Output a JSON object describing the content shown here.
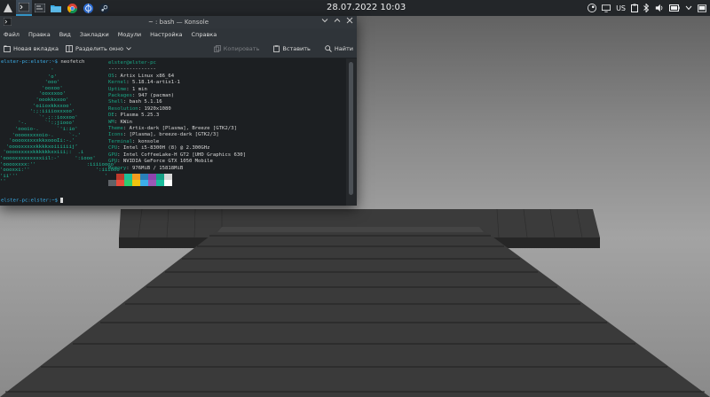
{
  "panel": {
    "clock": "28.07.2022 10:03",
    "lang": "US",
    "tasks": [
      {
        "name": "konsole-task-icon",
        "active": true
      },
      {
        "name": "terminal-task-icon"
      },
      {
        "name": "file-manager-task-icon"
      },
      {
        "name": "chrome-task-icon"
      },
      {
        "name": "browser-task-icon"
      },
      {
        "name": "steam-task-icon"
      }
    ]
  },
  "window": {
    "title": "~ : bash — Konsole",
    "menu": [
      "Файл",
      "Правка",
      "Вид",
      "Закладки",
      "Модули",
      "Настройка",
      "Справка"
    ],
    "toolbar": {
      "new_tab": "Новая вкладка",
      "split": "Разделить окно",
      "copy": "Копировать",
      "paste": "Вставить",
      "find": "Найти"
    }
  },
  "terminal": {
    "prompt_user": "elster-pc",
    "prompt_host": "elster",
    "prompt_full": "elster-pc:elster:~$",
    "command": "neofetch",
    "header": "elster@elster-pc",
    "separator": "----------------",
    "info": [
      {
        "k": "OS",
        "v": "Artix Linux x86_64"
      },
      {
        "k": "Kernel",
        "v": "5.18.14-artix1-1"
      },
      {
        "k": "Uptime",
        "v": "1 min"
      },
      {
        "k": "Packages",
        "v": "947 (pacman)"
      },
      {
        "k": "Shell",
        "v": "bash 5.1.16"
      },
      {
        "k": "Resolution",
        "v": "1920x1080"
      },
      {
        "k": "DE",
        "v": "Plasma 5.25.3"
      },
      {
        "k": "WM",
        "v": "KWin"
      },
      {
        "k": "Theme",
        "v": "Artix-dark [Plasma], Breeze [GTK2/3]"
      },
      {
        "k": "Icons",
        "v": "[Plasma], breeze-dark [GTK2/3]"
      },
      {
        "k": "Terminal",
        "v": "konsole"
      },
      {
        "k": "CPU",
        "v": "Intel i5-8300H (8) @ 2.300GHz"
      },
      {
        "k": "GPU",
        "v": "Intel CoffeeLake-H GT2 [UHD Graphics 630]"
      },
      {
        "k": "GPU",
        "v": "NVIDIA GeForce GTX 1050 Mobile"
      },
      {
        "k": "Memory",
        "v": "976MiB / 15818MiB"
      }
    ],
    "logo": "                 '\n                'o'\n               'ooo'\n              'ooxoo'\n             'ooxxxoo'\n            'oookkxxoo'\n           'oiioxkkxxoo'\n          ':;:iiiioxxxoo'\n             `'.;::ioxxoo'\n      '-.      `':;jiooo'\n     'oooio-.      `'i:io'\n    'ooooxxxxoio-.     `-.'\n   'ooooxxxxxkkxoooIi:-.'\n  'ooooxxxxxkkkkxoiiiiiij’\n 'ooooxxxxxkkkkkkxxiii;:  .i\n'ooooxxxxxxxxxiil:-'     ':iooo'\n'ooooxxxx:''                 :iiiioooo'\n'oooxxi:''                      ':iiiooo'\n'ii'''                             ':oo'\n''                                    `'",
    "swatches_top": [
      "#1c1f22",
      "#c0392b",
      "#1dbf9b",
      "#f39c1f",
      "#2980b9",
      "#8e44ad",
      "#16a085",
      "#d8d8d8"
    ],
    "swatches_bottom": [
      "#5f6368",
      "#e74c3c",
      "#2ecc71",
      "#f1c40f",
      "#3daee9",
      "#9b59b6",
      "#1abc9c",
      "#ffffff"
    ]
  }
}
